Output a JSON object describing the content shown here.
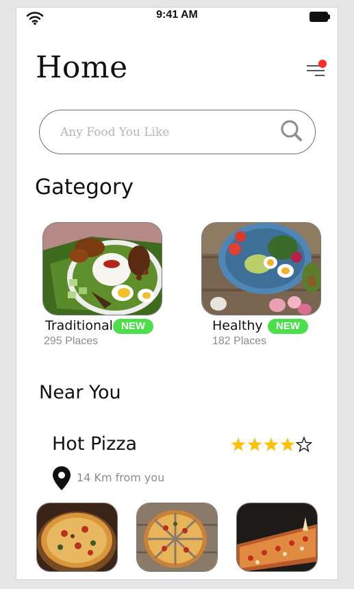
{
  "status": {
    "time": "9:41 AM"
  },
  "header": {
    "title": "Home"
  },
  "search": {
    "placeholder": "Any Food You Like"
  },
  "categories_title": "Gategory",
  "categories": [
    {
      "name": "Traditional",
      "badge": "NEW",
      "places": "295 Places",
      "image": "nasi-lemak-photo"
    },
    {
      "name": "Healthy",
      "badge": "NEW",
      "places": "182 Places",
      "image": "salad-bowl-photo"
    }
  ],
  "near_title": "Near You",
  "near_place": {
    "name": "Hot Pizza",
    "rating": 4,
    "rating_max": 5,
    "distance": "14 Km from you",
    "photos": [
      "pizza-whole-photo",
      "pizza-sliced-photo",
      "pizza-flatbread-photo"
    ]
  },
  "colors": {
    "badge": "#4be04b",
    "notification_dot": "#ff2b2b",
    "star": "#ffc107"
  }
}
